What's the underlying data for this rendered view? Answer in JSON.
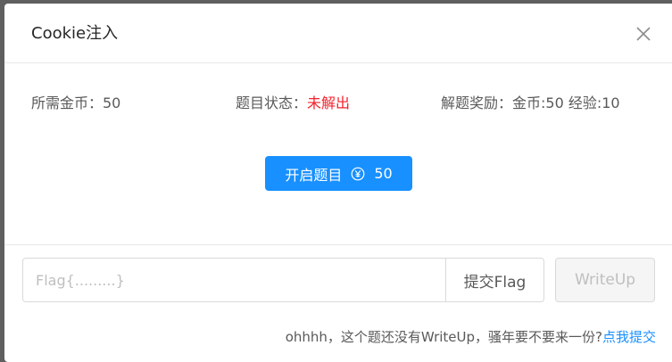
{
  "modal": {
    "title": "Cookie注入"
  },
  "info": {
    "coins_required": "所需金币：50",
    "status_label": "题目状态：",
    "status_value": "未解出",
    "reward": "解题奖励：金币:50 经验:10"
  },
  "start_button": {
    "label": "开启题目",
    "cost": "50"
  },
  "flag_input": {
    "placeholder": "Flag{.........}",
    "value": ""
  },
  "submit_button": {
    "label": "提交Flag"
  },
  "writeup_button": {
    "label": "WriteUp"
  },
  "notice": {
    "text": "ohhhh，这个题还没有WriteUp，骚年要不要来一份?",
    "link": "点我提交"
  },
  "colors": {
    "primary": "#1890ff",
    "status_unsolved": "#f5222d"
  }
}
